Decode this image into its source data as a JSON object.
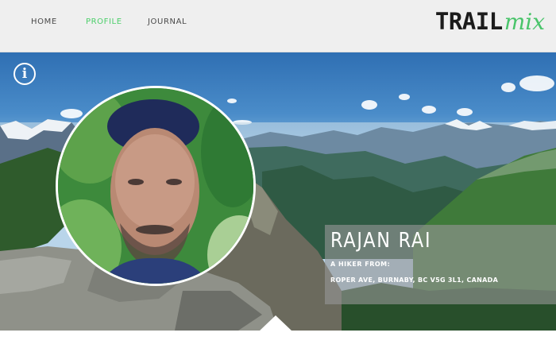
{
  "nav": {
    "items": [
      {
        "label": "HOME",
        "active": false
      },
      {
        "label": "PROFILE",
        "active": true
      },
      {
        "label": "JOURNAL",
        "active": false
      }
    ]
  },
  "logo": {
    "trail": "TRAIL",
    "mix": "mix"
  },
  "hero": {
    "info_icon": "info-circle-icon",
    "info_glyph": "i"
  },
  "profile": {
    "name": "RAJAN RAI",
    "tagline": "A HIKER FROM:",
    "location": "ROPER AVE, BURNABY, BC V5G 3L1, CANADA"
  },
  "colors": {
    "accent": "#4ccf6a",
    "nav_bg": "#efefef",
    "text": "#4a4a4a"
  }
}
